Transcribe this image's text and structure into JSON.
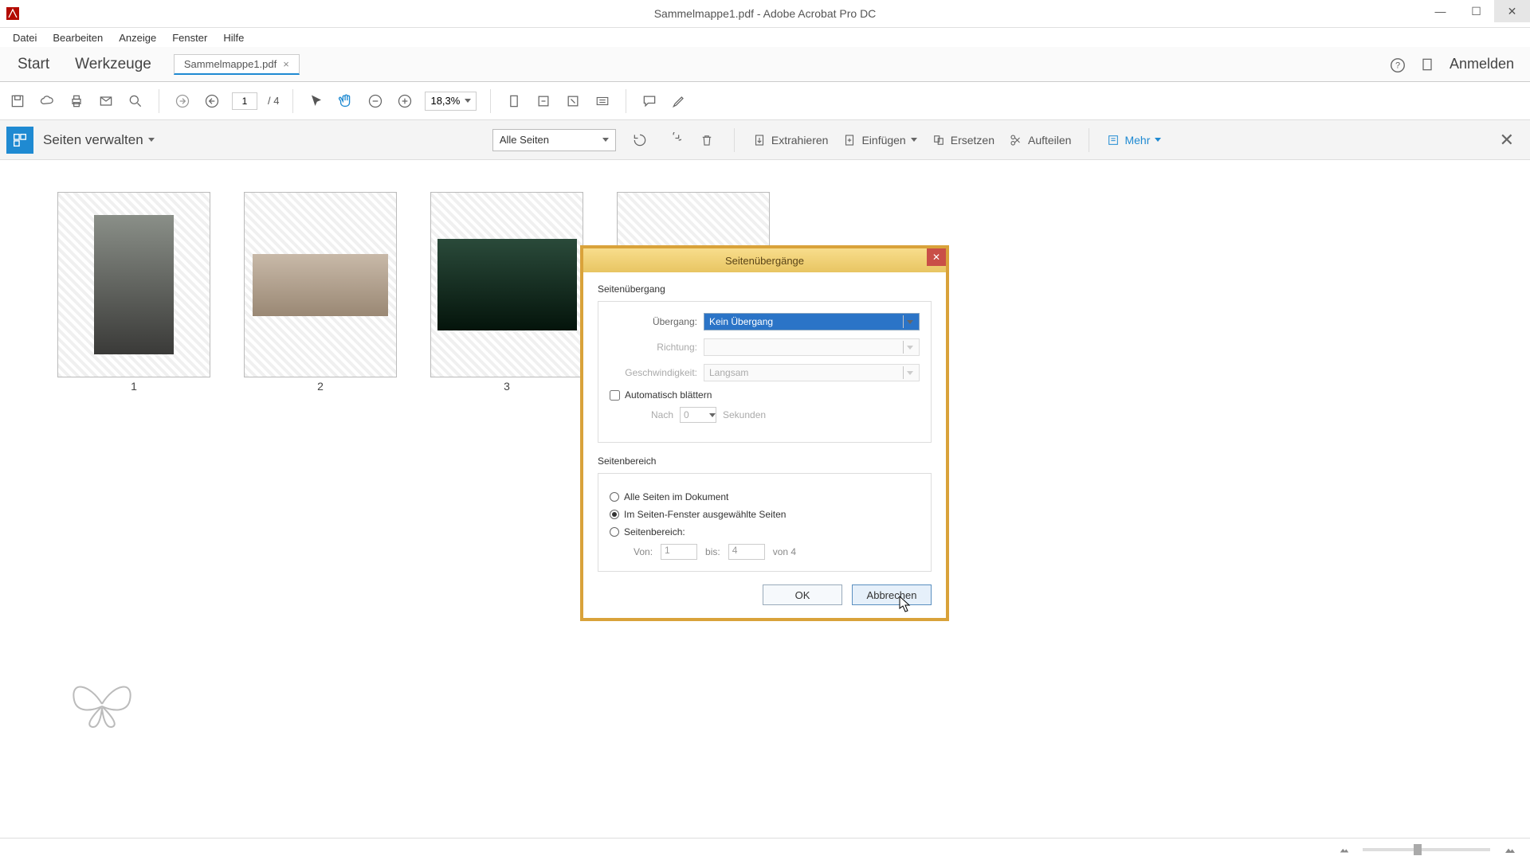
{
  "window": {
    "title": "Sammelmappe1.pdf - Adobe Acrobat Pro DC"
  },
  "menu": {
    "file": "Datei",
    "edit": "Bearbeiten",
    "view": "Anzeige",
    "window": "Fenster",
    "help": "Hilfe"
  },
  "tabs": {
    "start": "Start",
    "tools": "Werkzeuge",
    "doc": "Sammelmappe1.pdf",
    "login": "Anmelden"
  },
  "toolbar": {
    "page_current": "1",
    "page_total": "/ 4",
    "zoom": "18,3%"
  },
  "context": {
    "title": "Seiten verwalten",
    "all_pages": "Alle Seiten",
    "extract": "Extrahieren",
    "insert": "Einfügen",
    "replace": "Ersetzen",
    "split": "Aufteilen",
    "more": "Mehr"
  },
  "thumbs": {
    "p1": "1",
    "p2": "2",
    "p3": "3"
  },
  "dialog": {
    "title": "Seitenübergänge",
    "group_transition": "Seitenübergang",
    "label_transition": "Übergang:",
    "value_transition": "Kein Übergang",
    "label_direction": "Richtung:",
    "label_speed": "Geschwindigkeit:",
    "value_speed": "Langsam",
    "auto_flip": "Automatisch blättern",
    "after_label": "Nach",
    "after_value": "0",
    "seconds": "Sekunden",
    "group_range": "Seitenbereich",
    "radio_all": "Alle Seiten im Dokument",
    "radio_selected": "Im Seiten-Fenster ausgewählte Seiten",
    "radio_range": "Seitenbereich:",
    "from_label": "Von:",
    "from_value": "1",
    "to_label": "bis:",
    "to_value": "4",
    "of_total": "von 4",
    "ok": "OK",
    "cancel": "Abbrechen"
  }
}
